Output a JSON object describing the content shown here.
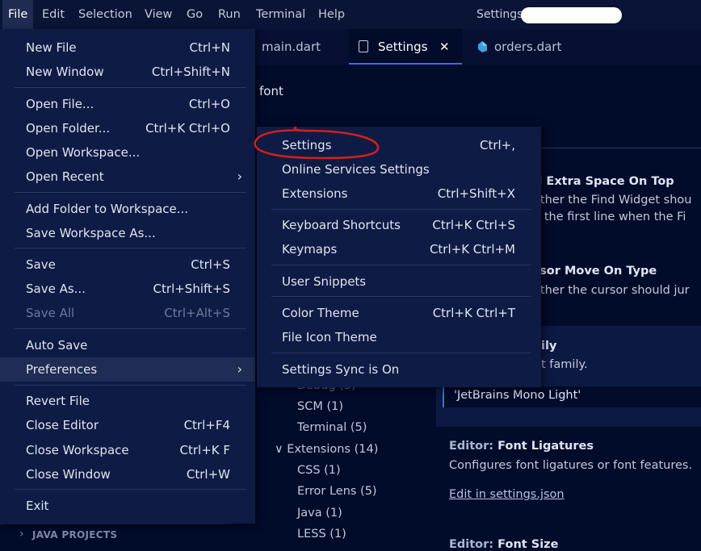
{
  "menubar": {
    "items": [
      "File",
      "Edit",
      "Selection",
      "View",
      "Go",
      "Run",
      "Terminal",
      "Help"
    ],
    "window_title": "Settings -"
  },
  "tabs": [
    {
      "label": "main.dart"
    },
    {
      "label": "Settings",
      "close": "✕"
    },
    {
      "label": "orders.dart"
    }
  ],
  "settings": {
    "search_query": "font",
    "find_extra_space": {
      "title": "d Extra Space On Top",
      "desc1": "ether the Find Widget shou",
      "desc2": "d the first line when the Fi"
    },
    "cursor_move": {
      "title": "rsor Move On Type",
      "desc1": "ether the cursor should jur"
    },
    "font_family": {
      "title": "ily",
      "desc1": "t family.",
      "value": "'JetBrains Mono Light'"
    },
    "font_ligatures": {
      "category": "Editor:",
      "title": "Font Ligatures",
      "desc": "Configures font ligatures or font features.",
      "link": "Edit in settings.json"
    },
    "font_size": {
      "category": "Editor:",
      "title": "Font Size"
    },
    "toc": {
      "debug": "Debug (3)",
      "scm": "SCM (1)",
      "terminal": "Terminal (5)",
      "extensions": "Extensions (14)",
      "ext_chevron": "∨",
      "css": "CSS (1)",
      "errorlens": "Error Lens (5)",
      "java": "Java (1)",
      "less": "LESS (1)"
    }
  },
  "file_menu": {
    "new_file": {
      "label": "New File",
      "key": "Ctrl+N"
    },
    "new_window": {
      "label": "New Window",
      "key": "Ctrl+Shift+N"
    },
    "open_file": {
      "label": "Open File...",
      "key": "Ctrl+O"
    },
    "open_folder": {
      "label": "Open Folder...",
      "key": "Ctrl+K Ctrl+O"
    },
    "open_workspace": {
      "label": "Open Workspace..."
    },
    "open_recent": {
      "label": "Open Recent"
    },
    "add_folder": {
      "label": "Add Folder to Workspace..."
    },
    "save_workspace_as": {
      "label": "Save Workspace As..."
    },
    "save": {
      "label": "Save",
      "key": "Ctrl+S"
    },
    "save_as": {
      "label": "Save As...",
      "key": "Ctrl+Shift+S"
    },
    "save_all": {
      "label": "Save All",
      "key": "Ctrl+Alt+S"
    },
    "auto_save": {
      "label": "Auto Save"
    },
    "preferences": {
      "label": "Preferences"
    },
    "revert_file": {
      "label": "Revert File"
    },
    "close_editor": {
      "label": "Close Editor",
      "key": "Ctrl+F4"
    },
    "close_workspace": {
      "label": "Close Workspace",
      "key": "Ctrl+K F"
    },
    "close_window": {
      "label": "Close Window",
      "key": "Ctrl+W"
    },
    "exit": {
      "label": "Exit"
    }
  },
  "pref_menu": {
    "settings": {
      "label": "Settings",
      "key": "Ctrl+,"
    },
    "online_services": {
      "label": "Online Services Settings"
    },
    "extensions": {
      "label": "Extensions",
      "key": "Ctrl+Shift+X"
    },
    "keyboard_shortcuts": {
      "label": "Keyboard Shortcuts",
      "key": "Ctrl+K Ctrl+S"
    },
    "keymaps": {
      "label": "Keymaps",
      "key": "Ctrl+K Ctrl+M"
    },
    "user_snippets": {
      "label": "User Snippets"
    },
    "color_theme": {
      "label": "Color Theme",
      "key": "Ctrl+K Ctrl+T"
    },
    "file_icon_theme": {
      "label": "File Icon Theme"
    },
    "settings_sync": {
      "label": "Settings Sync is On"
    }
  },
  "explorer": {
    "java_projects": "JAVA PROJECTS",
    "chevron": "›"
  },
  "colors": {
    "annotation_circle": "#d41e1e",
    "accent": "#3d6ee6"
  }
}
